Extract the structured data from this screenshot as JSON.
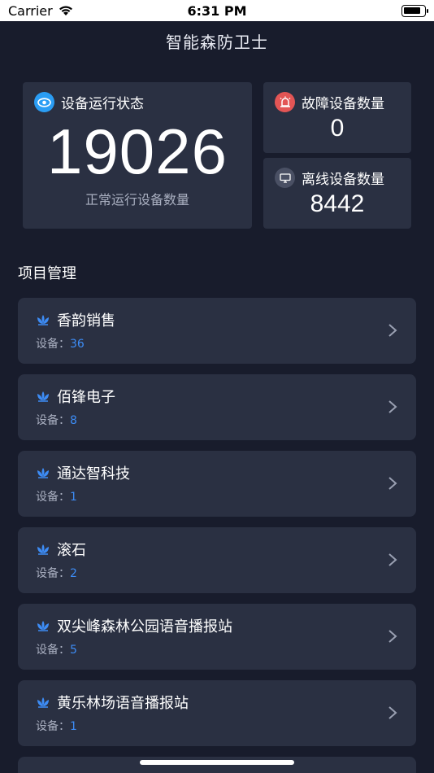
{
  "status_bar": {
    "carrier": "Carrier",
    "time": "6:31 PM"
  },
  "app": {
    "title": "智能森防卫士"
  },
  "summary": {
    "main": {
      "label": "设备运行状态",
      "value": "19026",
      "caption": "正常运行设备数量",
      "icon": "eye-icon"
    },
    "fault": {
      "label": "故障设备数量",
      "value": "0",
      "icon": "alarm-icon"
    },
    "offline": {
      "label": "离线设备数量",
      "value": "8442",
      "icon": "offline-monitor-icon"
    }
  },
  "projects_section": {
    "title": "项目管理"
  },
  "projects": [
    {
      "name": "香韵销售",
      "device_label": "设备：",
      "count": "36"
    },
    {
      "name": "佰锋电子",
      "device_label": "设备：",
      "count": "8"
    },
    {
      "name": "通达智科技",
      "device_label": "设备：",
      "count": "1"
    },
    {
      "name": "滚石",
      "device_label": "设备：",
      "count": "2"
    },
    {
      "name": "双尖峰森林公园语音播报站",
      "device_label": "设备：",
      "count": "5"
    },
    {
      "name": "黄乐林场语音播报站",
      "device_label": "设备：",
      "count": "1"
    }
  ],
  "colors": {
    "background": "#181c2c",
    "card": "#2a3042",
    "accent_blue": "#3d8cf5",
    "alert_red": "#e35555"
  }
}
